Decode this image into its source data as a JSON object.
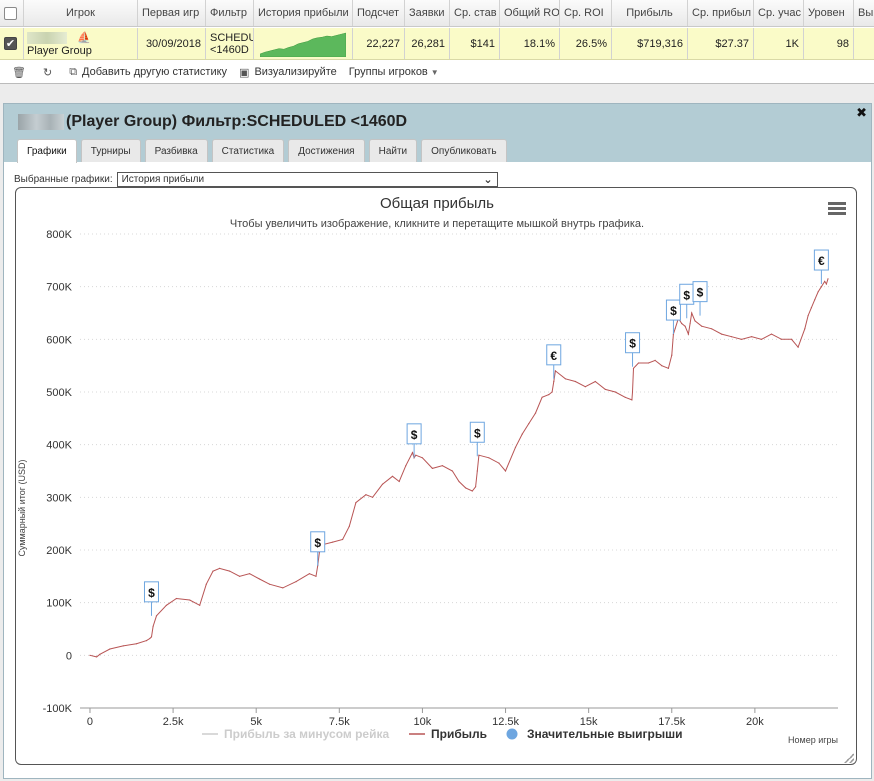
{
  "grid": {
    "headers": [
      "Игрок",
      "Первая игр",
      "Фильтр",
      "История прибыли",
      "Подсчет",
      "Заявки",
      "Ср. став",
      "Общий RO",
      "Ср. ROI",
      "Прибыль",
      "Ср. прибыл",
      "Ср. учас",
      "Уровен",
      "Вы"
    ],
    "row": {
      "player_name": "Player Group",
      "first_game": "30/09/2018",
      "filter_line1": "SCHEDU",
      "filter_line2": "<1460D",
      "count": "22,227",
      "entries": "26,281",
      "avg_stake": "$141",
      "total_roi": "18.1%",
      "avg_roi": "26.5%",
      "profit": "$719,316",
      "avg_profit": "$27.37",
      "avg_field": "1K",
      "level": "98"
    }
  },
  "toolbar": {
    "add_stats": "Добавить другую статистику",
    "visualize": "Визуализируйте",
    "groups": "Группы игроков"
  },
  "panel": {
    "title": "(Player Group) Фильтр:SCHEDULED <1460D",
    "tabs": [
      "Графики",
      "Турниры",
      "Разбивка",
      "Статистика",
      "Достижения",
      "Найти",
      "Опубликовать"
    ],
    "active_tab": "Графики",
    "select_label": "Выбранные графики:",
    "select_value": "История прибыли"
  },
  "chart_data": {
    "type": "line",
    "title": "Общая прибыль",
    "subtitle": "Чтобы увеличить изображение, кликните и перетащите мышкой внутрь графика.",
    "ylabel": "Суммарный итог (USD)",
    "xlabel": "Номер игры",
    "ylim": [
      -100000,
      800000
    ],
    "xlim": [
      -300,
      22500
    ],
    "y_ticks": [
      -100000,
      0,
      100000,
      200000,
      300000,
      400000,
      500000,
      600000,
      700000,
      800000
    ],
    "y_tick_labels": [
      "-100K",
      "0",
      "100K",
      "200K",
      "300K",
      "400K",
      "500K",
      "600K",
      "700K",
      "800K"
    ],
    "x_ticks": [
      0,
      2500,
      5000,
      7500,
      10000,
      12500,
      15000,
      17500,
      20000
    ],
    "x_tick_labels": [
      "0",
      "2.5k",
      "5k",
      "7.5k",
      "10k",
      "12.5k",
      "15k",
      "17.5k",
      "20k"
    ],
    "grid": true,
    "legend_position": "bottom",
    "legend": [
      {
        "name": "Прибыль за минусом рейка",
        "color": "#cccccc",
        "kind": "line"
      },
      {
        "name": "Прибыль",
        "color": "#b85555",
        "kind": "line"
      },
      {
        "name": "Значительные выигрыши",
        "color": "#6ea6e0",
        "kind": "dot"
      }
    ],
    "series": [
      {
        "name": "Прибыль",
        "color": "#b85555",
        "x": [
          0,
          200,
          300,
          600,
          1000,
          1400,
          1700,
          1800,
          1850,
          1900,
          2000,
          2300,
          2600,
          3000,
          3300,
          3500,
          3700,
          3900,
          4200,
          4500,
          4800,
          5100,
          5400,
          5800,
          6200,
          6600,
          6800,
          6850,
          6900,
          7000,
          7300,
          7600,
          7800,
          8000,
          8300,
          8500,
          8800,
          9100,
          9300,
          9500,
          9700,
          9750,
          9800,
          10000,
          10300,
          10600,
          10900,
          11100,
          11300,
          11500,
          11600,
          11650,
          11700,
          12000,
          12300,
          12500,
          12800,
          13000,
          13200,
          13400,
          13600,
          13800,
          13900,
          13950,
          14000,
          14300,
          14600,
          14900,
          15200,
          15500,
          15800,
          16100,
          16300,
          16320,
          16350,
          16500,
          16800,
          17000,
          17200,
          17400,
          17500,
          17550,
          17600,
          17700,
          17800,
          17900,
          18000,
          18050,
          18100,
          18200,
          18400,
          18700,
          19000,
          19300,
          19600,
          19900,
          20200,
          20500,
          20800,
          21100,
          21300,
          21500,
          21600,
          21700,
          21800,
          21900,
          22000,
          22100,
          22150,
          22200
        ],
        "y": [
          0,
          -3000,
          2000,
          12000,
          18000,
          22000,
          28000,
          32000,
          35000,
          55000,
          75000,
          95000,
          108000,
          105000,
          95000,
          135000,
          160000,
          165000,
          160000,
          150000,
          155000,
          145000,
          135000,
          128000,
          140000,
          155000,
          150000,
          170000,
          195000,
          210000,
          215000,
          220000,
          245000,
          290000,
          305000,
          300000,
          325000,
          340000,
          330000,
          360000,
          385000,
          375000,
          380000,
          375000,
          355000,
          360000,
          350000,
          330000,
          318000,
          312000,
          320000,
          350000,
          380000,
          375000,
          365000,
          350000,
          395000,
          420000,
          440000,
          460000,
          490000,
          495000,
          500000,
          520000,
          540000,
          525000,
          520000,
          510000,
          520000,
          505000,
          500000,
          490000,
          485000,
          500000,
          545000,
          555000,
          555000,
          560000,
          550000,
          545000,
          570000,
          610000,
          620000,
          640000,
          630000,
          625000,
          610000,
          630000,
          650000,
          635000,
          625000,
          620000,
          610000,
          605000,
          600000,
          605000,
          600000,
          610000,
          600000,
          600000,
          585000,
          620000,
          645000,
          660000,
          675000,
          690000,
          700000,
          710000,
          705000,
          715000
        ]
      },
      {
        "name": "Прибыль за минусом рейка",
        "color": "#cccccc",
        "x": [],
        "y": []
      }
    ],
    "big_wins": [
      {
        "x": 1850,
        "y": 75000,
        "symbol": "$"
      },
      {
        "x": 6850,
        "y": 170000,
        "symbol": "$"
      },
      {
        "x": 9750,
        "y": 375000,
        "symbol": "$"
      },
      {
        "x": 11650,
        "y": 378000,
        "symbol": "$"
      },
      {
        "x": 13950,
        "y": 525000,
        "symbol": "€"
      },
      {
        "x": 16320,
        "y": 548000,
        "symbol": "$"
      },
      {
        "x": 17550,
        "y": 610000,
        "symbol": "$"
      },
      {
        "x": 17950,
        "y": 640000,
        "symbol": "$"
      },
      {
        "x": 18350,
        "y": 645000,
        "symbol": "$"
      },
      {
        "x": 22000,
        "y": 705000,
        "symbol": "€"
      }
    ]
  },
  "sparkline": [
    5,
    8,
    10,
    12,
    14,
    13,
    16,
    18,
    22,
    24,
    26,
    30,
    32,
    33,
    35,
    34,
    36,
    38,
    40
  ]
}
